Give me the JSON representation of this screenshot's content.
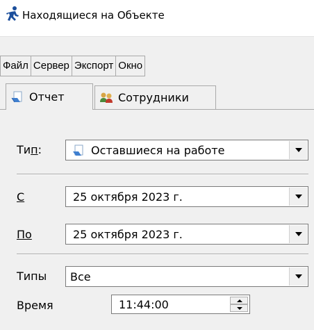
{
  "window": {
    "title": "Находящиеся на Объекте",
    "icon": "running-person-icon"
  },
  "menu": [
    "Файл",
    "Сервер",
    "Экспорт",
    "Окно"
  ],
  "tabs": [
    {
      "label": "Отчет",
      "icon": "report-icon",
      "active": true
    },
    {
      "label": "Сотрудники",
      "icon": "employees-icon",
      "active": false
    }
  ],
  "form": {
    "type": {
      "label_pre": "Ти",
      "label_ul": "п",
      "label_post": ":",
      "value": "Оставшиеся на работе",
      "icon": "report-icon"
    },
    "from": {
      "label": "С",
      "value": "25  октября  2023 г."
    },
    "to": {
      "label": "По",
      "value": "25  октября  2023 г."
    },
    "types": {
      "label": "Типы",
      "value": "Все"
    },
    "time": {
      "label": "Время",
      "value": "11:44:00"
    }
  }
}
